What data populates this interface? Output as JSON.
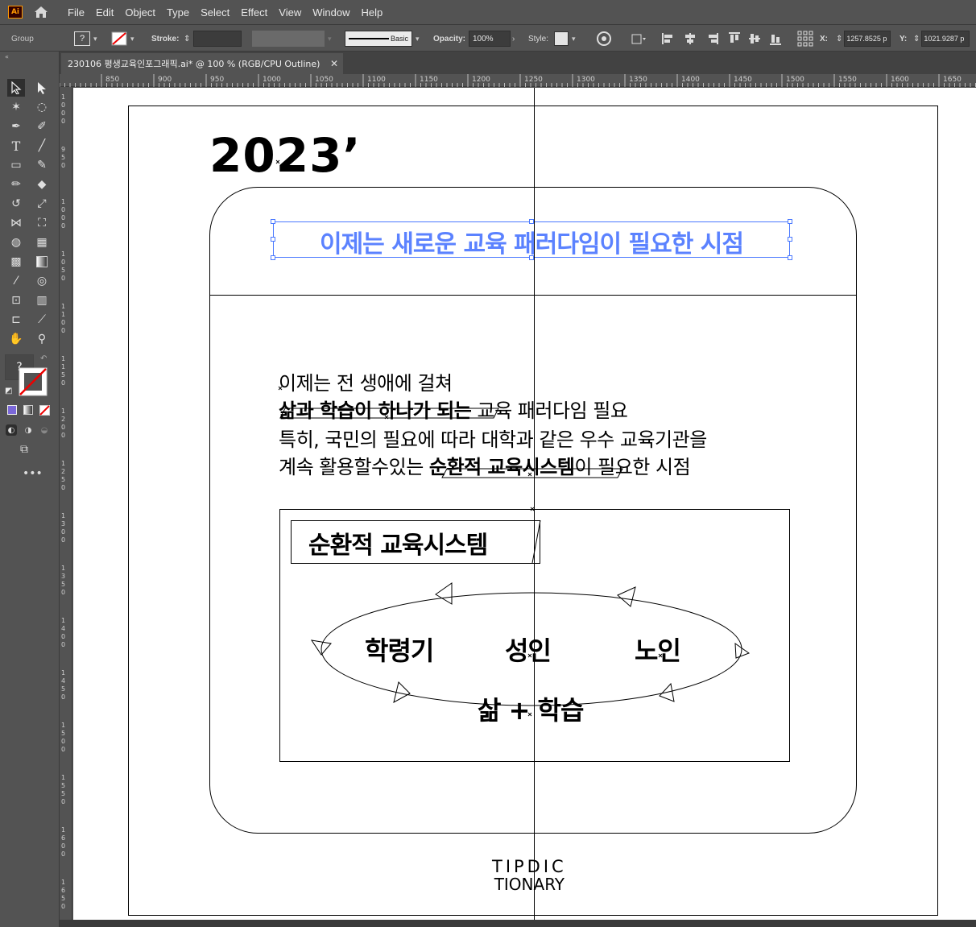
{
  "app": {
    "logo": "Ai"
  },
  "menu": [
    "File",
    "Edit",
    "Object",
    "Type",
    "Select",
    "Effect",
    "View",
    "Window",
    "Help"
  ],
  "control_bar": {
    "selection": "Group",
    "stroke_label": "Stroke:",
    "brush_label": "Basic",
    "opacity_label": "Opacity:",
    "opacity_value": "100%",
    "style_label": "Style:",
    "x_label": "X:",
    "x_value": "1257.8525 p",
    "y_label": "Y:",
    "y_value": "1021.9287 p"
  },
  "document_tab": {
    "title": "230106 평생교육인포그래픽.ai* @ 100 % (RGB/CPU Outline)"
  },
  "ruler": {
    "top": [
      "850",
      "900",
      "950",
      "1000",
      "1050",
      "1100",
      "1150",
      "1200",
      "1250",
      "1300",
      "1350",
      "1400",
      "1450",
      "1500",
      "1550",
      "1600",
      "1650"
    ],
    "left": [
      "1000",
      "950",
      "1000",
      "1050",
      "1100",
      "1150",
      "1200",
      "1250",
      "1300",
      "1350",
      "1400",
      "1450",
      "1500",
      "1550",
      "1600",
      "1650"
    ]
  },
  "artwork": {
    "year": "2023’",
    "headline": "이제는 새로운 교육 패러다임이 필요한 시점",
    "paragraph": {
      "line1": "이제는 전 생애에 걸쳐",
      "line2_bold": "삶과 학습이 하나가 되는",
      "line2_rest": " 교육 패러다임 필요",
      "line3": "특히, 국민의 필요에 따라 대학과 같은 우수 교육기관을",
      "line4_start": "계속 활용할수있는 ",
      "line4_bold": "순환적 교육시스템",
      "line4_end": "이 필요한 시점"
    },
    "system_title": "순환적 교육시스템",
    "cycle": {
      "stage1": "학령기",
      "stage2": "성인",
      "stage3": "노인",
      "bottom": "삶 + 학습"
    },
    "logo_line1": "TIPDIC",
    "logo_line2": "TIONARY"
  }
}
